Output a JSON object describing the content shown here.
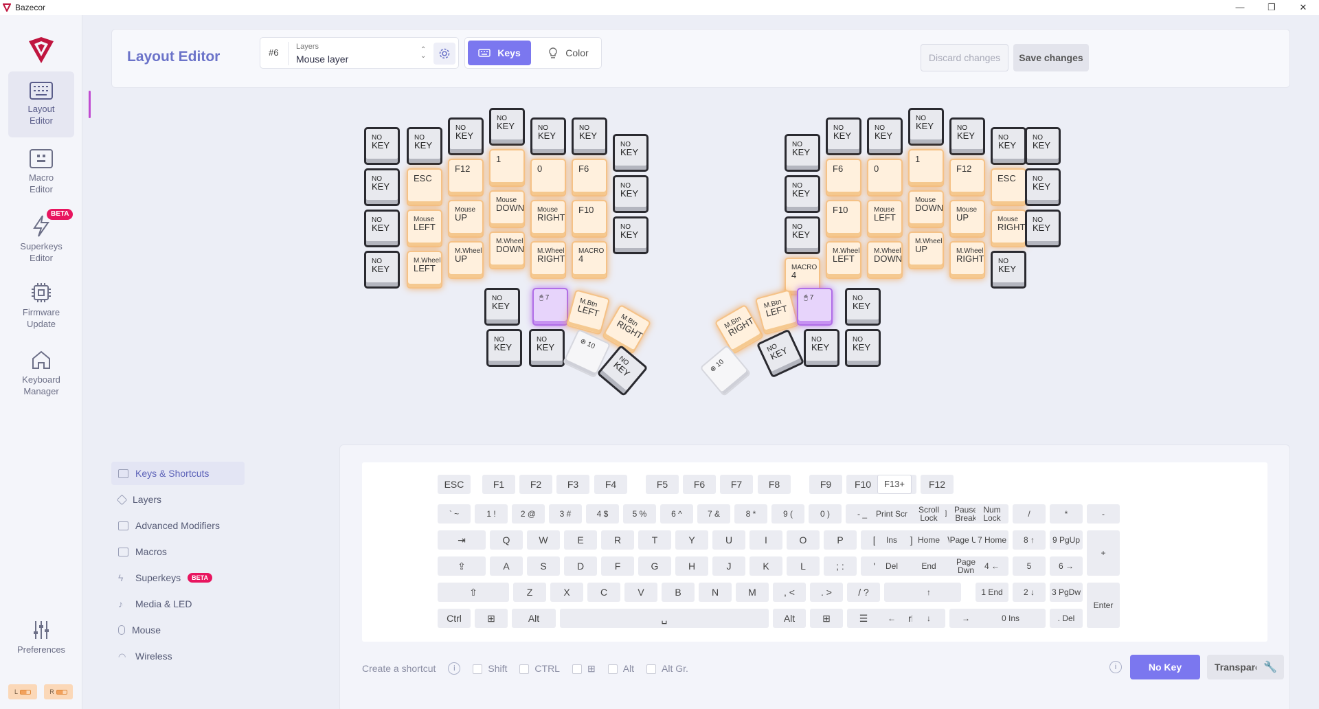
{
  "app": {
    "title": "Bazecor",
    "window_buttons": [
      "—",
      "❐",
      "✕"
    ]
  },
  "sidebar": {
    "items": [
      {
        "label": "Layout Editor",
        "icon": "keyboard-icon"
      },
      {
        "label": "Macro Editor",
        "icon": "macro-icon"
      },
      {
        "label": "Superkeys Editor",
        "icon": "superkeys-icon",
        "badge": "BETA"
      },
      {
        "label": "Firmware Update",
        "icon": "chip-icon"
      },
      {
        "label": "Keyboard Manager",
        "icon": "home-icon"
      }
    ],
    "preferences": "Preferences",
    "battery_left": "L",
    "battery_right": "R"
  },
  "header": {
    "title": "Layout Editor",
    "layer_number": "#6",
    "layer_label": "Layers",
    "layer_value": "Mouse layer",
    "mode_keys": "Keys",
    "mode_color": "Color",
    "discard": "Discard changes",
    "save": "Save changes"
  },
  "keyboard": {
    "left_keys": [
      {
        "l1": "NO",
        "l2": "KEY",
        "c": "none"
      },
      {
        "l1": "NO",
        "l2": "KEY",
        "c": "none"
      },
      {
        "l1": "NO",
        "l2": "KEY",
        "c": "none"
      },
      {
        "l1": "NO",
        "l2": "KEY",
        "c": "none"
      },
      {
        "l1": "NO",
        "l2": "KEY",
        "c": "none"
      },
      {
        "l1": "NO",
        "l2": "KEY",
        "c": "none"
      },
      {
        "l1": "NO",
        "l2": "KEY",
        "c": "none"
      },
      {
        "l1": "NO",
        "l2": "KEY",
        "c": "none"
      },
      {
        "l1": "",
        "l2": "ESC",
        "c": "or"
      },
      {
        "l1": "",
        "l2": "F12",
        "c": "or"
      },
      {
        "l1": "",
        "l2": "1",
        "c": "or"
      },
      {
        "l1": "",
        "l2": "0",
        "c": "or"
      },
      {
        "l1": "",
        "l2": "F6",
        "c": "or"
      },
      {
        "l1": "NO",
        "l2": "KEY",
        "c": "none"
      },
      {
        "l1": "NO",
        "l2": "KEY",
        "c": "none"
      },
      {
        "l1": "Mouse",
        "l2": "LEFT",
        "c": "or"
      },
      {
        "l1": "Mouse",
        "l2": "UP",
        "c": "or"
      },
      {
        "l1": "Mouse",
        "l2": "DOWN",
        "c": "or"
      },
      {
        "l1": "Mouse",
        "l2": "RIGHT",
        "c": "or"
      },
      {
        "l1": "",
        "l2": "F10",
        "c": "or"
      },
      {
        "l1": "NO",
        "l2": "KEY",
        "c": "none"
      },
      {
        "l1": "NO",
        "l2": "KEY",
        "c": "none"
      },
      {
        "l1": "M.Wheel",
        "l2": "LEFT",
        "c": "or"
      },
      {
        "l1": "M.Wheel",
        "l2": "UP",
        "c": "or"
      },
      {
        "l1": "M.Wheel",
        "l2": "DOWN",
        "c": "or"
      },
      {
        "l1": "M.Wheel",
        "l2": "RIGHT",
        "c": "or"
      },
      {
        "l1": "MACRO",
        "l2": "4",
        "c": "or"
      }
    ],
    "left_thumbs": [
      {
        "l1": "NO",
        "l2": "KEY",
        "c": "none"
      },
      {
        "l1": "🖰 7",
        "l2": "",
        "c": "pu"
      },
      {
        "l1": "M.Btn",
        "l2": "LEFT",
        "c": "or"
      },
      {
        "l1": "M.Btn",
        "l2": "RIGHT",
        "c": "or"
      },
      {
        "l1": "NO",
        "l2": "KEY",
        "c": "none"
      },
      {
        "l1": "NO",
        "l2": "KEY",
        "c": "none"
      },
      {
        "l1": "⊕ 10",
        "l2": "",
        "c": "wh"
      },
      {
        "l1": "NO",
        "l2": "KEY",
        "c": "none"
      }
    ],
    "right_keys": [
      {
        "l1": "NO",
        "l2": "KEY",
        "c": "none"
      },
      {
        "l1": "NO",
        "l2": "KEY",
        "c": "none"
      },
      {
        "l1": "NO",
        "l2": "KEY",
        "c": "none"
      },
      {
        "l1": "NO",
        "l2": "KEY",
        "c": "none"
      },
      {
        "l1": "NO",
        "l2": "KEY",
        "c": "none"
      },
      {
        "l1": "NO",
        "l2": "KEY",
        "c": "none"
      },
      {
        "l1": "NO",
        "l2": "KEY",
        "c": "none"
      },
      {
        "l1": "NO",
        "l2": "KEY",
        "c": "none"
      },
      {
        "l1": "",
        "l2": "F6",
        "c": "or"
      },
      {
        "l1": "",
        "l2": "0",
        "c": "or"
      },
      {
        "l1": "",
        "l2": "1",
        "c": "or"
      },
      {
        "l1": "",
        "l2": "F12",
        "c": "or"
      },
      {
        "l1": "",
        "l2": "ESC",
        "c": "or"
      },
      {
        "l1": "NO",
        "l2": "KEY",
        "c": "none"
      },
      {
        "l1": "NO",
        "l2": "KEY",
        "c": "none"
      },
      {
        "l1": "",
        "l2": "F10",
        "c": "or"
      },
      {
        "l1": "Mouse",
        "l2": "LEFT",
        "c": "or"
      },
      {
        "l1": "Mouse",
        "l2": "DOWN",
        "c": "or"
      },
      {
        "l1": "Mouse",
        "l2": "UP",
        "c": "or"
      },
      {
        "l1": "Mouse",
        "l2": "RIGHT",
        "c": "or"
      },
      {
        "l1": "NO",
        "l2": "KEY",
        "c": "none"
      },
      {
        "l1": "MACRO",
        "l2": "4",
        "c": "or"
      },
      {
        "l1": "M.Wheel",
        "l2": "LEFT",
        "c": "or"
      },
      {
        "l1": "M.Wheel",
        "l2": "DOWN",
        "c": "or"
      },
      {
        "l1": "M.Wheel",
        "l2": "UP",
        "c": "or"
      },
      {
        "l1": "M.Wheel",
        "l2": "RIGHT",
        "c": "or"
      },
      {
        "l1": "NO",
        "l2": "KEY",
        "c": "none"
      }
    ],
    "right_thumbs": [
      {
        "l1": "M.Btn",
        "l2": "RIGHT",
        "c": "or"
      },
      {
        "l1": "M.Btn",
        "l2": "LEFT",
        "c": "or"
      },
      {
        "l1": "🖰 7",
        "l2": "",
        "c": "pu"
      },
      {
        "l1": "NO",
        "l2": "KEY",
        "c": "none"
      },
      {
        "l1": "NO",
        "l2": "KEY",
        "c": "none"
      },
      {
        "l1": "⊕ 10",
        "l2": "",
        "c": "wh"
      },
      {
        "l1": "NO",
        "l2": "KEY",
        "c": "none"
      },
      {
        "l1": "NO",
        "l2": "KEY",
        "c": "none"
      }
    ]
  },
  "panel_nav": [
    {
      "label": "Keys & Shortcuts"
    },
    {
      "label": "Layers"
    },
    {
      "label": "Advanced Modifiers"
    },
    {
      "label": "Macros"
    },
    {
      "label": "Superkeys",
      "badge": "BETA"
    },
    {
      "label": "Media & LED"
    },
    {
      "label": "Mouse"
    },
    {
      "label": "Wireless"
    }
  ],
  "vkb": {
    "fn_row": [
      "ESC",
      "F1",
      "F2",
      "F3",
      "F4",
      "F5",
      "F6",
      "F7",
      "F8",
      "F9",
      "F10",
      "F11",
      "F12"
    ],
    "f13": "F13+",
    "num_row": [
      "` ~",
      "1 !",
      "2 @",
      "3 #",
      "4 $",
      "5 %",
      "6 ^",
      "7 &",
      "8 *",
      "9 (",
      "0 )",
      "- _",
      "= +",
      "⌫"
    ],
    "q_row": [
      "⇥",
      "Q",
      "W",
      "E",
      "R",
      "T",
      "Y",
      "U",
      "I",
      "O",
      "P",
      "[ {",
      "] }",
      "\\ |"
    ],
    "a_row": [
      "⇪",
      "A",
      "S",
      "D",
      "F",
      "G",
      "H",
      "J",
      "K",
      "L",
      "; :",
      "' \"",
      "↵"
    ],
    "z_row": [
      "⇧",
      "Z",
      "X",
      "C",
      "V",
      "B",
      "N",
      "M",
      ", <",
      ". >",
      "/ ?",
      "⇧"
    ],
    "mod_row": [
      "Ctrl",
      "⊞",
      "Alt",
      "␣",
      "Alt",
      "⊞",
      "☰",
      "Ctrl"
    ],
    "nav": [
      "Print Scr",
      "Scroll Lock",
      "Pause Break",
      "Ins",
      "Home",
      "Page Up",
      "Del",
      "End",
      "Page Dwn",
      "↑",
      "←",
      "↓",
      "→"
    ],
    "numpad": [
      "Num Lock",
      "/",
      "*",
      "-",
      "7 Home",
      "8 ↑",
      "9 PgUp",
      "+",
      "4 ←",
      "5",
      "6 →",
      "1 End",
      "2 ↓",
      "3 PgDw",
      "Enter",
      "0 Ins",
      ". Del"
    ]
  },
  "shortcut": {
    "label": "Create a shortcut",
    "mods": [
      "Shift",
      "CTRL",
      "⊞",
      "Alt",
      "Alt Gr."
    ]
  },
  "buttons": {
    "no_key": "No Key",
    "transparent": "Transparent"
  },
  "colors": {
    "accent": "#7b77ef",
    "orange": "#f39c43",
    "purple": "#b06ee7",
    "beta": "#e8155f"
  }
}
